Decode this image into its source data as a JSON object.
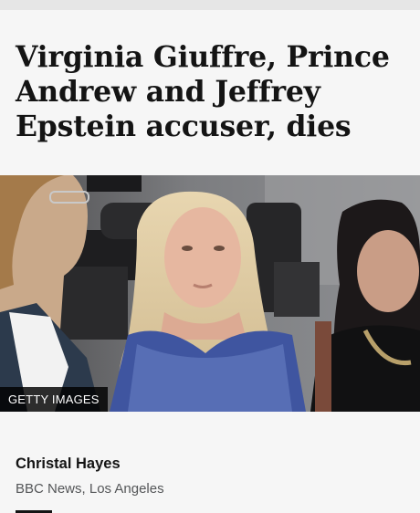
{
  "article": {
    "headline": "Virginia Giuffre, Prince Andrew and Jeffrey Epstein accuser, dies",
    "image": {
      "credit": "GETTY IMAGES"
    },
    "byline": {
      "author": "Christal Hayes",
      "affiliation": "BBC News, Los Angeles"
    }
  }
}
